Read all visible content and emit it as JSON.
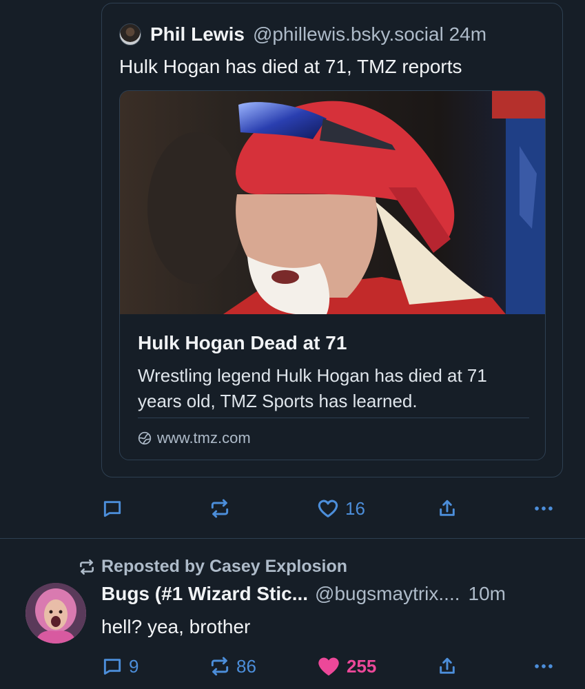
{
  "quoted_post": {
    "author_name": "Phil Lewis",
    "handle": "@phillewis.bsky.social",
    "time": "24m",
    "text": "Hulk Hogan has died at 71, TMZ reports",
    "link_card": {
      "title": "Hulk Hogan Dead at 71",
      "description": "Wrestling legend Hulk Hogan has died at 71 years old, TMZ Sports has learned.",
      "domain": "www.tmz.com"
    }
  },
  "quoted_actions": {
    "reply_icon": "reply-icon",
    "repost_icon": "repost-icon",
    "like_icon": "heart-outline-icon",
    "like_count": "16",
    "share_icon": "share-icon",
    "more_icon": "more-icon"
  },
  "post": {
    "repost_label": "Reposted by Casey Explosion",
    "author_name": "Bugs (#1 Wizard Stic...",
    "handle": "@bugsmaytrix....",
    "time": "10m",
    "text": "hell? yea, brother",
    "reply_count": "9",
    "repost_count": "86",
    "like_count": "255"
  },
  "colors": {
    "background": "#161e27",
    "border": "#2e4052",
    "muted_text": "#aebbc9",
    "icon": "#4c8eda",
    "like_active": "#ec4899"
  }
}
